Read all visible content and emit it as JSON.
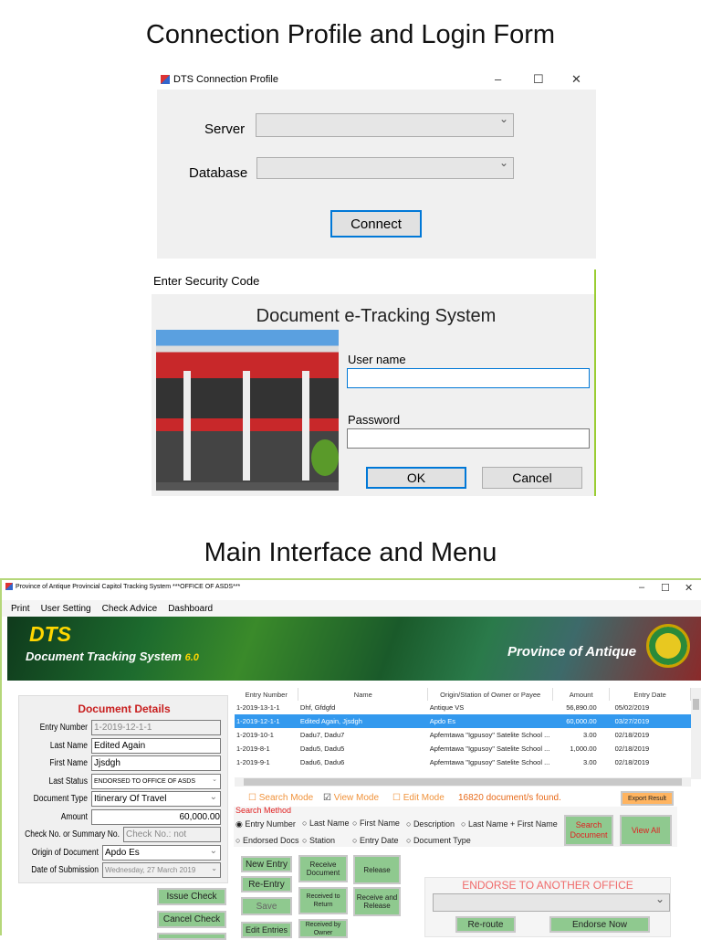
{
  "headings": {
    "top": "Connection Profile and Login Form",
    "bottom": "Main Interface and Menu"
  },
  "connection": {
    "title": "DTS Connection Profile",
    "server_label": "Server",
    "database_label": "Database",
    "connect_label": "Connect",
    "server_value": "",
    "database_value": ""
  },
  "login": {
    "window_title": "Enter Security Code",
    "title": "Document e-Tracking System",
    "username_label": "User name",
    "password_label": "Password",
    "username_value": "",
    "password_value": "",
    "ok_label": "OK",
    "cancel_label": "Cancel"
  },
  "main": {
    "title": "Province of Antique Provincial Capitol Tracking System ***OFFICE OF ASDS***",
    "menu": [
      "Print",
      "User Setting",
      "Check Advice",
      "Dashboard"
    ],
    "banner": {
      "logo": "DTS",
      "subtitle": "Document Tracking System",
      "version": "6.0",
      "province": "Province of Antique"
    },
    "details": {
      "title": "Document Details",
      "fields": [
        {
          "label": "Entry Number",
          "value": "1-2019-12-1-1"
        },
        {
          "label": "Last Name",
          "value": "Edited Again"
        },
        {
          "label": "First Name",
          "value": "Jjsdgh"
        },
        {
          "label": "Last Status",
          "value": "ENDORSED TO OFFICE OF ASDS"
        },
        {
          "label": "Document Type",
          "value": "Itinerary Of Travel"
        },
        {
          "label": "Amount",
          "value": "60,000.00"
        },
        {
          "label": "Check No. or Summary No.",
          "value": "Check No.: not"
        },
        {
          "label": "Origin of Document",
          "value": "Apdo Es"
        },
        {
          "label": "Date of Submission",
          "value": "Wednesday, 27    March    2019"
        }
      ]
    },
    "side_buttons": [
      "Issue Check",
      "Cancel Check"
    ],
    "table": {
      "columns": [
        "Entry Number",
        "Name",
        "Origin/Station of Owner or Payee",
        "Amount",
        "Entry Date"
      ],
      "rows": [
        [
          "1-2019-13-1-1",
          "Dhf, Gfdgfd",
          "Antique VS",
          "56,890.00",
          "05/02/2019"
        ],
        [
          "1-2019-12-1-1",
          "Edited Again, Jjsdgh",
          "Apdo Es",
          "60,000.00",
          "03/27/2019"
        ],
        [
          "1-2019-10-1",
          "Dadu7, Dadu7",
          "Apfemtawa \"Igpusoy\" Satelite School ...",
          "3.00",
          "02/18/2019"
        ],
        [
          "1-2019-8-1",
          "Dadu5, Dadu5",
          "Apfemtawa \"Igpusoy\" Satelite School ...",
          "1,000.00",
          "02/18/2019"
        ],
        [
          "1-2019-9-1",
          "Dadu6, Dadu6",
          "Apfemtawa \"Igpusoy\" Satelite School ...",
          "3.00",
          "02/18/2019"
        ]
      ],
      "selected_row": 1
    },
    "modes": {
      "search": "Search Mode",
      "view": "View Mode",
      "edit": "Edit Mode",
      "found": "16820 document/s found.",
      "export": "Export Result"
    },
    "search": {
      "title": "Search Method",
      "options": [
        "Entry Number",
        "Last Name",
        "First Name",
        "Description",
        "Last Name + First Name",
        "Endorsed Docs",
        "Station",
        "Entry Date",
        "Document Type"
      ],
      "search_button": "Search Document",
      "view_all": "View All"
    },
    "actions": {
      "new_entry": "New Entry",
      "re_entry": "Re-Entry",
      "save": "Save",
      "edit_entries": "Edit Entries",
      "receive_document": "Receive Document",
      "received_to_return": "Received to Return",
      "received_by_owner": "Received by Owner",
      "release": "Release",
      "receive_and_release": "Receive and Release"
    },
    "endorse": {
      "title": "ENDORSE TO ANOTHER OFFICE",
      "reroute": "Re-route",
      "endorse_now": "Endorse Now"
    }
  }
}
